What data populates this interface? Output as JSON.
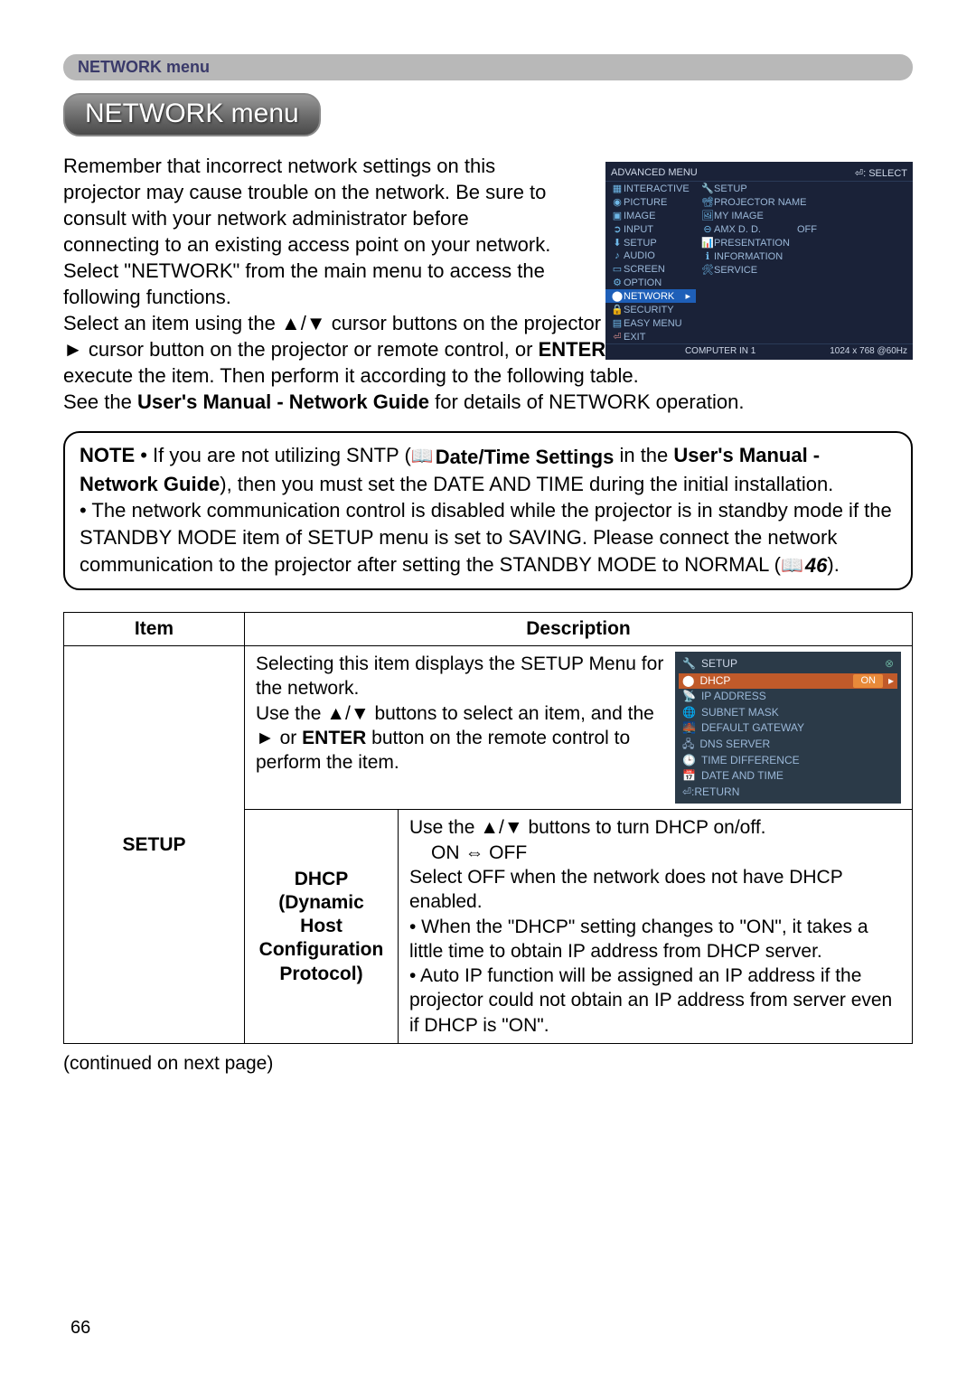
{
  "topbar": {
    "label": "NETWORK menu"
  },
  "title": "NETWORK menu",
  "intro": {
    "p1a": "Remember that incorrect network settings on this projector may cause trouble on the network. Be sure to consult with your network administrator before connecting to an existing access point on your network.",
    "p1b": "Select \"NETWORK\" from the main menu to access the following functions.",
    "p2": "Select an item using the ▲/▼ cursor buttons on the projector or remote control, and press the ► cursor button on the projector or remote control, or ",
    "p2b": "ENTER",
    "p2c": " button on the remote control to execute the item. Then perform it according to the following table.",
    "p3a": "See the ",
    "p3b": "User's Manual - Network Guide",
    "p3c": " for details of NETWORK operation."
  },
  "osd_main": {
    "header_left": "ADVANCED MENU",
    "header_right": "⏎: SELECT",
    "left_items": [
      "INTERACTIVE",
      "PICTURE",
      "IMAGE",
      "INPUT",
      "SETUP",
      "AUDIO",
      "SCREEN",
      "OPTION",
      "NETWORK",
      "SECURITY",
      "EASY MENU",
      "EXIT"
    ],
    "right_items": [
      {
        "label": "SETUP",
        "val": ""
      },
      {
        "label": "PROJECTOR NAME",
        "val": ""
      },
      {
        "label": "MY IMAGE",
        "val": ""
      },
      {
        "label": "AMX D. D.",
        "val": "OFF"
      },
      {
        "label": "PRESENTATION",
        "val": ""
      },
      {
        "label": "INFORMATION",
        "val": ""
      },
      {
        "label": "SERVICE",
        "val": ""
      }
    ],
    "footer_mid": "COMPUTER IN 1",
    "footer_right": "1024 x 768 @60Hz"
  },
  "note": {
    "label": "NOTE",
    "l1a": " • If you are not utilizing SNTP (",
    "l1b": "Date/Time Settings",
    "l1c": " in the ",
    "l1d": "User's Manual - Network Guide",
    "l1e": "), then you must set the DATE AND TIME during the initial installation.",
    "l2": "• The network communication control is disabled while the projector is in standby mode if the STANDBY MODE item of SETUP menu is set to SAVING. Please connect the network communication to the projector after setting the STANDBY MODE to NORMAL (",
    "l2ref": "46",
    "l2end": ")."
  },
  "table": {
    "h_item": "Item",
    "h_desc": "Description",
    "setup_label": "SETUP",
    "setup_desc_a": "Selecting this item displays the SETUP Menu for the network.",
    "setup_desc_b": "Use the ▲/▼ buttons to select an item, and the ► or ",
    "setup_desc_bold": "ENTER",
    "setup_desc_c": " button on the remote control to perform the item.",
    "dhcp_label": "DHCP",
    "dhcp_sub": "(Dynamic Host Configuration Protocol)",
    "dhcp_l1": "Use the ▲/▼ buttons to turn DHCP on/off.",
    "dhcp_l2": "ON ⇔ OFF",
    "dhcp_l3": "Select OFF when the network does not have DHCP enabled.",
    "dhcp_l4": "• When the \"DHCP\" setting changes to \"ON\", it takes a little time to obtain IP address from DHCP server.",
    "dhcp_l5": "• Auto IP function will be assigned an IP address if the projector could not obtain an IP address from server even if DHCP is \"ON\"."
  },
  "osd_setup": {
    "title": "SETUP",
    "items": [
      {
        "label": "DHCP",
        "val": "ON",
        "hl": true
      },
      {
        "label": "IP ADDRESS"
      },
      {
        "label": "SUBNET MASK"
      },
      {
        "label": "DEFAULT GATEWAY"
      },
      {
        "label": "DNS SERVER"
      },
      {
        "label": "TIME DIFFERENCE"
      },
      {
        "label": "DATE AND TIME"
      },
      {
        "label": "⏎:RETURN"
      }
    ]
  },
  "continued": "(continued on next page)",
  "page_number": "66"
}
